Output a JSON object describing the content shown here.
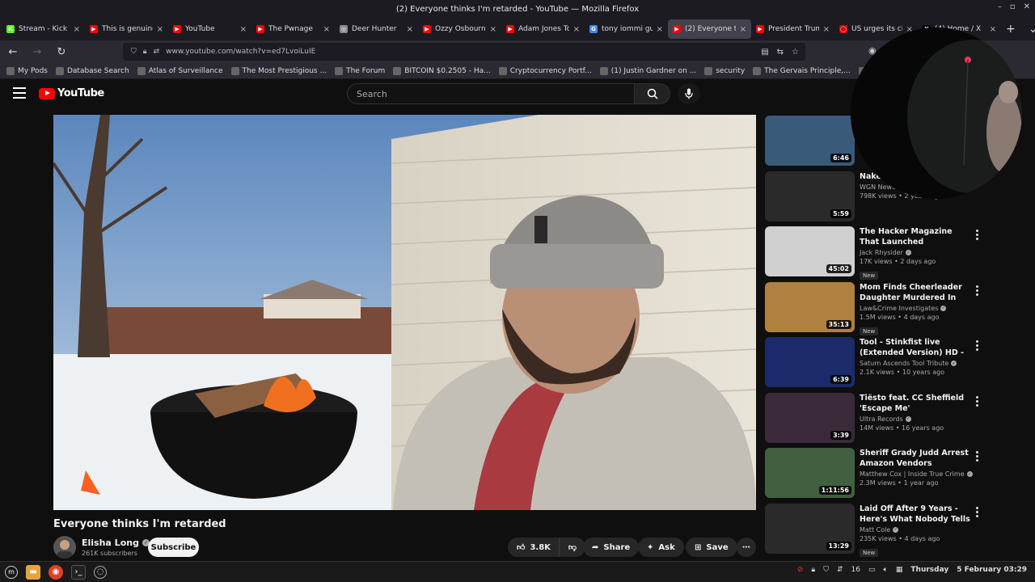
{
  "window": {
    "title": "(2) Everyone thinks I'm retarded - YouTube — Mozilla Firefox"
  },
  "tabs": [
    {
      "label": "Stream - Kick D",
      "color": "#53fc18",
      "glyph": "K"
    },
    {
      "label": "This is genuinel",
      "color": "#ff0000",
      "glyph": "▶"
    },
    {
      "label": "YouTube",
      "color": "#ff0000",
      "glyph": "▶"
    },
    {
      "label": "The Pwnage",
      "color": "#ff0000",
      "glyph": "▶"
    },
    {
      "label": "Deer Hunter",
      "color": "#888888",
      "glyph": "◎"
    },
    {
      "label": "Ozzy Osbourne",
      "color": "#ff0000",
      "glyph": "▶"
    },
    {
      "label": "Adam Jones To",
      "color": "#ff0000",
      "glyph": "▶"
    },
    {
      "label": "tony iommi guit",
      "color": "#4285f4",
      "glyph": "G"
    },
    {
      "label": "(2) Everyone th",
      "color": "#ff0000",
      "glyph": "▶"
    },
    {
      "label": "President Trum",
      "color": "#ff0000",
      "glyph": "▶"
    },
    {
      "label": "US urges its citi",
      "color": "#cc0000",
      "glyph": "◯"
    },
    {
      "label": "(4) Home / X",
      "color": "#000000",
      "glyph": "X"
    }
  ],
  "active_tab_index": 8,
  "tab_tools": {
    "new_tab": "+",
    "list": "⌄"
  },
  "nav": {
    "url": "www.youtube.com/watch?v=ed7LvoiLuIE"
  },
  "bookmarks": [
    "My Pods",
    "Database Search",
    "Atlas of Surveillance",
    "The Most Prestigious ...",
    "The Forum",
    "BITCOIN $0.2505 - Ha...",
    "Cryptocurrency Portf...",
    "(1) Justin Gardner on ...",
    "security",
    "The Gervais Principle,...",
    "Z-Library – the world's"
  ],
  "youtube": {
    "logo": "YouTube",
    "search_placeholder": "Search"
  },
  "video": {
    "title": "Everyone thinks I'm retarded",
    "channel": "Elisha Long",
    "subscribers": "261K subscribers",
    "subscribe_label": "Subscribe",
    "likes": "3.8K",
    "share_label": "Share",
    "ask_label": "Ask",
    "save_label": "Save"
  },
  "recommendations": [
    {
      "title": "",
      "channel": "",
      "meta": "",
      "duration": "6:46",
      "new": false,
      "thumb": "#3a5a7a"
    },
    {
      "title": "Naked ... in indecency",
      "channel": "WGN News",
      "meta": "798K views • 2 years ago",
      "duration": "5:59",
      "new": false,
      "thumb": "#2a2a2a"
    },
    {
      "title": "The Hacker Magazine That Launched Thousands of Cyber...",
      "channel": "Jack Rhysider",
      "meta": "17K views • 2 days ago",
      "duration": "45:02",
      "new": true,
      "thumb": "#d0d0d0"
    },
    {
      "title": "Mom Finds Cheerleader Daughter Murdered In Her Ow...",
      "channel": "Law&Crime Investigates",
      "meta": "1.5M views • 4 days ago",
      "duration": "35:13",
      "new": true,
      "thumb": "#b08040"
    },
    {
      "title": "Tool - Stinkfist live (Extended Version) HD - 2015 - Saturn ...",
      "channel": "Saturn Ascends Tool Tribute",
      "meta": "2.1K views • 10 years ago",
      "duration": "6:39",
      "new": false,
      "thumb": "#1a2a6a"
    },
    {
      "title": "Tiësto feat. CC Sheffield 'Escape Me'",
      "channel": "Ultra Records",
      "meta": "14M views • 16 years ago",
      "duration": "3:39",
      "new": false,
      "thumb": "#3a2a3a"
    },
    {
      "title": "Sheriff Grady Judd Arrest Amazon Vendors",
      "channel": "Matthew Cox | Inside True Crime",
      "meta": "2.3M views • 1 year ago",
      "duration": "1:11:56",
      "new": false,
      "thumb": "#406040"
    },
    {
      "title": "Laid Off After 9 Years - Here's What Nobody Tells You",
      "channel": "Matt Cole",
      "meta": "235K views • 4 days ago",
      "duration": "13:29",
      "new": true,
      "thumb": "#2a2a2a"
    }
  ],
  "taskbar": {
    "day": "Thursday",
    "date": "5 February 03:29",
    "volume": "16"
  }
}
